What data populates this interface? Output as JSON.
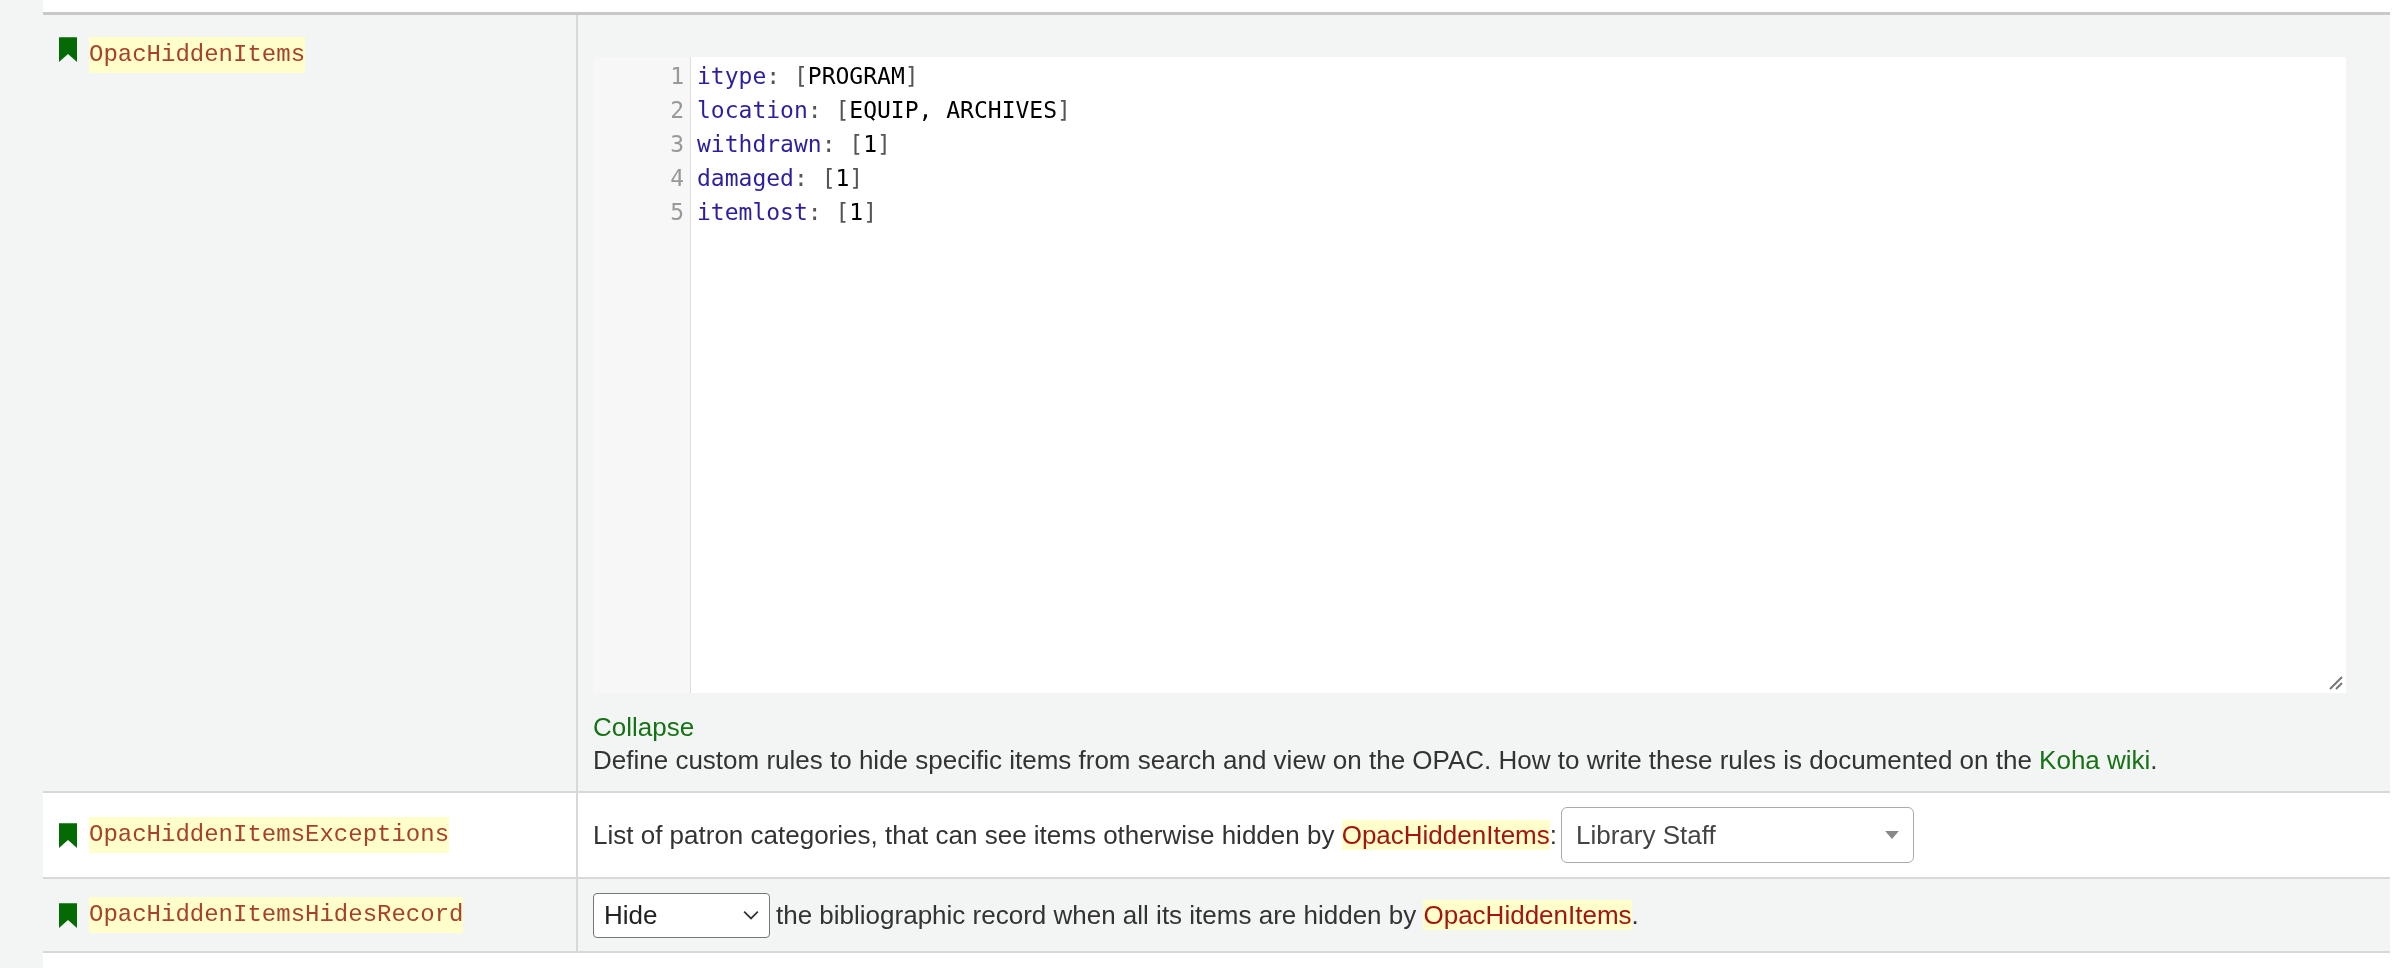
{
  "preferences": [
    {
      "name": "OpacHiddenItems",
      "kind": "code",
      "editor": {
        "lines": [
          [
            {
              "kind": "key",
              "text": "itype"
            },
            {
              "kind": "punct",
              "text": ": ["
            },
            {
              "kind": "value",
              "text": "PROGRAM"
            },
            {
              "kind": "punct",
              "text": "]"
            }
          ],
          [
            {
              "kind": "key",
              "text": "location"
            },
            {
              "kind": "punct",
              "text": ": ["
            },
            {
              "kind": "value",
              "text": "EQUIP, ARCHIVES"
            },
            {
              "kind": "punct",
              "text": "]"
            }
          ],
          [
            {
              "kind": "key",
              "text": "withdrawn"
            },
            {
              "kind": "punct",
              "text": ": ["
            },
            {
              "kind": "value",
              "text": "1"
            },
            {
              "kind": "punct",
              "text": "]"
            }
          ],
          [
            {
              "kind": "key",
              "text": "damaged"
            },
            {
              "kind": "punct",
              "text": ": ["
            },
            {
              "kind": "value",
              "text": "1"
            },
            {
              "kind": "punct",
              "text": "]"
            }
          ],
          [
            {
              "kind": "key",
              "text": "itemlost"
            },
            {
              "kind": "punct",
              "text": ": ["
            },
            {
              "kind": "value",
              "text": "1"
            },
            {
              "kind": "punct",
              "text": "]"
            }
          ]
        ],
        "line_numbers": [
          "1",
          "2",
          "3",
          "4",
          "5"
        ]
      },
      "collapse_link": "Collapse",
      "description": {
        "before": "Define custom rules to hide specific items from search and view on the OPAC. How to write these rules is documented on the ",
        "link": "Koha wiki",
        "after": "."
      }
    },
    {
      "name": "OpacHiddenItemsExceptions",
      "kind": "select_after",
      "text_before": "List of patron categories, that can see items otherwise hidden by ",
      "link": "OpacHiddenItems",
      "text_after": ":",
      "select": {
        "kind": "multi",
        "value": "Library Staff"
      }
    },
    {
      "name": "OpacHiddenItemsHidesRecord",
      "kind": "select_before",
      "select": {
        "kind": "native",
        "value": "Hide"
      },
      "text_before": " the bibliographic record when all its items are hidden by ",
      "link": "OpacHiddenItems",
      "text_after": "."
    }
  ]
}
